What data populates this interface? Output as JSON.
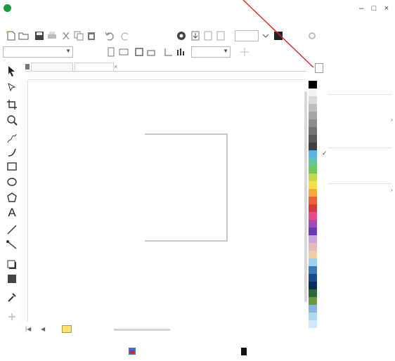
{
  "window": {
    "title": "",
    "minimize": "–",
    "maximize": "□",
    "close": "×"
  },
  "menubar": {
    "items": [
      {
        "label": ""
      },
      {
        "label": ""
      },
      {
        "label": ""
      },
      {
        "label": ""
      },
      {
        "label": ""
      },
      {
        "label": ""
      },
      {
        "label": ""
      },
      {
        "label": ""
      },
      {
        "label": ""
      },
      {
        "label": ""
      },
      {
        "label": ""
      },
      {
        "label": ""
      }
    ]
  },
  "toolbar1": {
    "zoom_value": "",
    "options_label": ""
  },
  "toolbar2": {
    "page_size": "",
    "width_value": "",
    "height_value": "",
    "units": ""
  },
  "toolbox": {
    "text_tool_glyph": "A"
  },
  "document_tabs": [
    {
      "label": ""
    },
    {
      "label": ""
    }
  ],
  "page_navigator": {
    "page_label": ""
  },
  "statusbar": {
    "coordinates": "",
    "fill_info": "",
    "outline_info": ""
  },
  "palette": {
    "colors": [
      "#ffffff",
      "#000000",
      "#f2f2f2",
      "#d9d9d9",
      "#bfbfbf",
      "#a6a6a6",
      "#8c8c8c",
      "#737373",
      "#595959",
      "#404040",
      "#5ab4e8",
      "#62c7a0",
      "#74c85a",
      "#c3d94a",
      "#f5e04a",
      "#f5a93c",
      "#e8623a",
      "#d43a3a",
      "#e84a8c",
      "#a34ab4",
      "#6a3ab4",
      "#c8a8d8",
      "#e8b8b8",
      "#f0d0a0",
      "#a0d0f0",
      "#3a7ab4",
      "#1a4a8c",
      "#0a2a5c",
      "#2a6a3a",
      "#6a9a3a",
      "#8ab4e0",
      "#b0d8f0",
      "#d0e8f8"
    ]
  },
  "right_menu": {
    "items": [
      {
        "label": ""
      },
      {
        "label": ""
      },
      {
        "label": ""
      },
      {
        "label": ""
      },
      {
        "label": ""
      },
      {
        "label": ""
      },
      {
        "label": ""
      },
      {
        "label": ""
      },
      {
        "label": ""
      },
      {
        "label": ""
      },
      {
        "label": ""
      },
      {
        "label": ""
      },
      {
        "label": ""
      },
      {
        "label": ""
      },
      {
        "label": ""
      }
    ],
    "check_mark": "✓"
  },
  "colors": {
    "accent_red": "#e02020",
    "page_outline": "#cec6bd",
    "app_icon": "#1d9a3e"
  }
}
